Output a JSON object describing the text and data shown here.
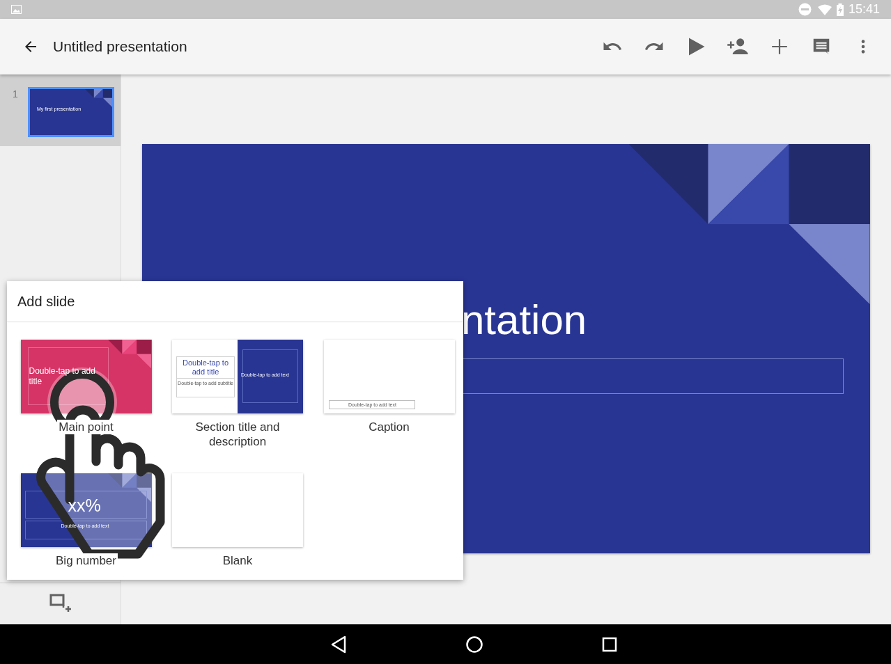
{
  "status_bar": {
    "time": "15:41"
  },
  "toolbar": {
    "title": "Untitled presentation"
  },
  "slides_panel": {
    "slides": [
      {
        "number": "1",
        "title": "My first presentation",
        "selected": true
      }
    ]
  },
  "slide": {
    "title": "ntation"
  },
  "add_slide_dialog": {
    "title": "Add slide",
    "layouts": [
      {
        "kind": "main-point",
        "label": "Main point",
        "title": "Double-tap to add title"
      },
      {
        "kind": "section",
        "label": "Section title and description",
        "title": "Double-tap to add title",
        "subtitle": "Double-tap to add subtitle",
        "body": "Double-tap to add text"
      },
      {
        "kind": "caption",
        "label": "Caption",
        "body": "Double-tap to add text"
      },
      {
        "kind": "big-number",
        "label": "Big number",
        "number": "xx%",
        "body": "Double-tap to add text"
      },
      {
        "kind": "blank",
        "label": "Blank"
      }
    ]
  }
}
